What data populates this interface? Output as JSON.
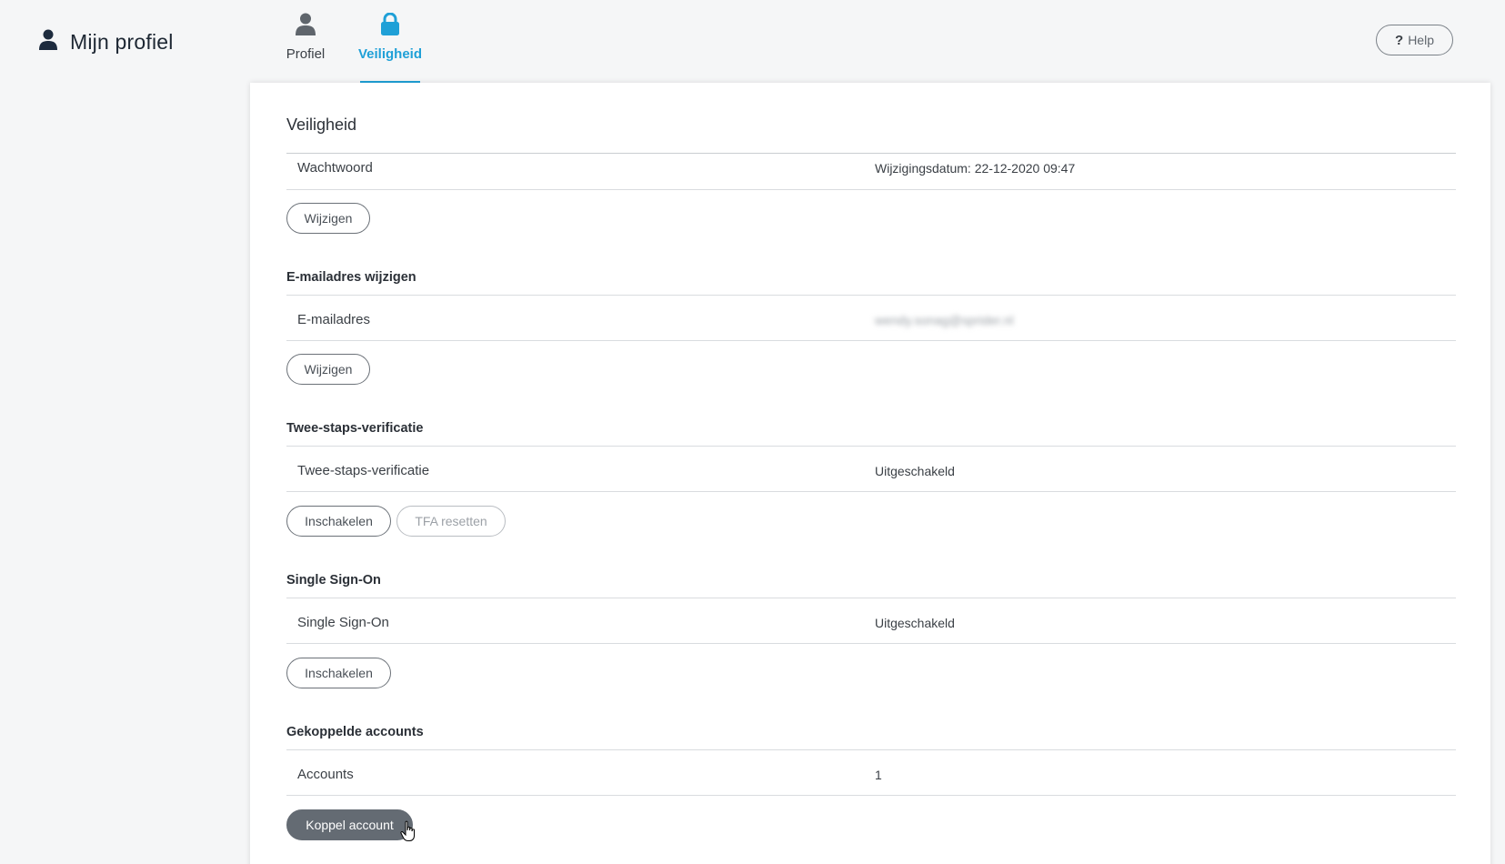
{
  "header": {
    "title": "Mijn profiel",
    "tabs": [
      {
        "label": "Profiel",
        "icon": "user-icon",
        "active": false
      },
      {
        "label": "Veiligheid",
        "icon": "lock-icon",
        "active": true
      }
    ],
    "help_label": "Help"
  },
  "security": {
    "title": "Veiligheid",
    "password": {
      "label": "Wachtwoord",
      "value": "Wijzigingsdatum: 22-12-2020 09:47",
      "button": "Wijzigen"
    },
    "email": {
      "heading": "E-mailadres wijzigen",
      "label": "E-mailadres",
      "value": "wendy.sonag@sprider.nl",
      "button": "Wijzigen"
    },
    "two_step": {
      "heading": "Twee-staps-verificatie",
      "label": "Twee-staps-verificatie",
      "value": "Uitgeschakeld",
      "enable_button": "Inschakelen",
      "reset_button": "TFA resetten"
    },
    "sso": {
      "heading": "Single Sign-On",
      "label": "Single Sign-On",
      "value": "Uitgeschakeld",
      "enable_button": "Inschakelen"
    },
    "linked": {
      "heading": "Gekoppelde accounts",
      "label": "Accounts",
      "value": "1",
      "button": "Koppel account"
    }
  },
  "colors": {
    "accent": "#1fa0d7",
    "text": "#3a3f45",
    "primary_button": "#646b73",
    "background": "#f5f6f7"
  }
}
